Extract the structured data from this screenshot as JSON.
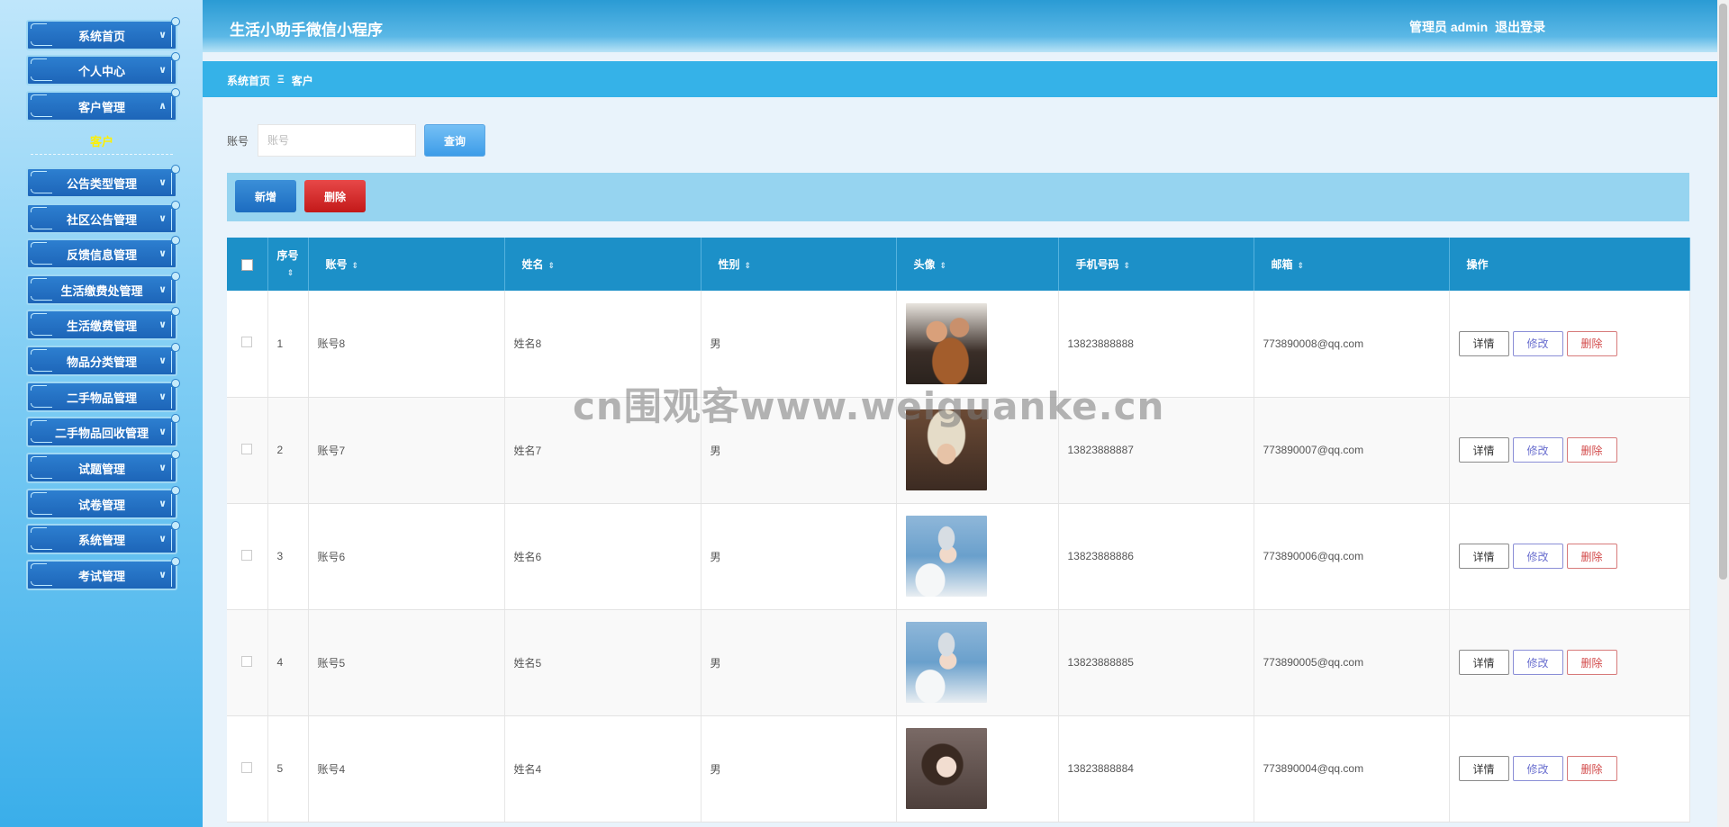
{
  "app": {
    "title": "生活小助手微信小程序"
  },
  "header": {
    "user": "管理员 admin",
    "logout": "退出登录"
  },
  "breadcrumb": {
    "home": "系统首页",
    "separator": "Ξ",
    "current": "客户"
  },
  "sidebar": {
    "items_top": [
      {
        "label": "系统首页"
      },
      {
        "label": "个人中心"
      },
      {
        "label": "客户管理"
      }
    ],
    "sub_item": "客户",
    "items": [
      {
        "label": "公告类型管理"
      },
      {
        "label": "社区公告管理"
      },
      {
        "label": "反馈信息管理"
      },
      {
        "label": "生活缴费处管理"
      },
      {
        "label": "生活缴费管理"
      },
      {
        "label": "物品分类管理"
      },
      {
        "label": "二手物品管理"
      },
      {
        "label": "二手物品回收管理"
      },
      {
        "label": "试题管理"
      },
      {
        "label": "试卷管理"
      },
      {
        "label": "系统管理"
      },
      {
        "label": "考试管理"
      }
    ]
  },
  "search": {
    "label": "账号",
    "placeholder": "账号",
    "button": "查询"
  },
  "actions": {
    "add": "新增",
    "delete": "删除"
  },
  "table": {
    "headers": {
      "index": "序号",
      "account": "账号",
      "name": "姓名",
      "gender": "性别",
      "avatar": "头像",
      "phone": "手机号码",
      "email": "邮箱",
      "ops": "操作"
    },
    "op_labels": {
      "detail": "详情",
      "edit": "修改",
      "delete": "删除"
    },
    "rows": [
      {
        "index": "1",
        "account": "账号8",
        "name": "姓名8",
        "gender": "男",
        "phone": "13823888888",
        "email": "773890008@qq.com",
        "avatar_icon": "couple-with-dog-photo"
      },
      {
        "index": "2",
        "account": "账号7",
        "name": "姓名7",
        "gender": "男",
        "phone": "13823888887",
        "email": "773890007@qq.com",
        "avatar_icon": "girl-with-hat-photo"
      },
      {
        "index": "3",
        "account": "账号6",
        "name": "姓名6",
        "gender": "男",
        "phone": "13823888886",
        "email": "773890006@qq.com",
        "avatar_icon": "girl-with-goggles-photo"
      },
      {
        "index": "4",
        "account": "账号5",
        "name": "姓名5",
        "gender": "男",
        "phone": "13823888885",
        "email": "773890005@qq.com",
        "avatar_icon": "girl-with-goggles-photo"
      },
      {
        "index": "5",
        "account": "账号4",
        "name": "姓名4",
        "gender": "男",
        "phone": "13823888884",
        "email": "773890004@qq.com",
        "avatar_icon": "girl-portrait-photo"
      }
    ]
  },
  "watermark": "cn围观客www.weiguanke.cn",
  "colors": {
    "header": "#2a9bd4",
    "crumbbar": "#35b2e8",
    "table_header": "#1c90c8",
    "add_button": "#1c6cc0",
    "delete_button": "#c31919",
    "sidebar_active": "#fff000"
  }
}
